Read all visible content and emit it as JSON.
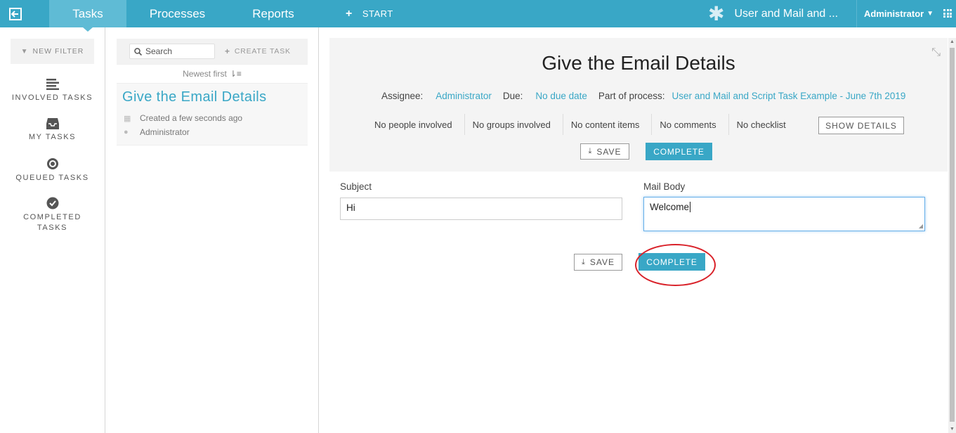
{
  "topbar": {
    "tabs": [
      {
        "label": "Tasks",
        "active": true
      },
      {
        "label": "Processes",
        "active": false
      },
      {
        "label": "Reports",
        "active": false
      }
    ],
    "start_label": "START",
    "app_name": "User and Mail and ...",
    "user_name": "Administrator",
    "accent_color": "#39a7c6"
  },
  "sidebar": {
    "new_filter": "NEW FILTER",
    "items": [
      {
        "label": "INVOLVED TASKS",
        "icon": "list-icon"
      },
      {
        "label": "MY TASKS",
        "icon": "inbox-icon"
      },
      {
        "label": "QUEUED TASKS",
        "icon": "target-icon"
      },
      {
        "label": "COMPLETED TASKS",
        "icon": "check-circle-icon"
      }
    ]
  },
  "task_list": {
    "search_placeholder": "Search",
    "create_task": "CREATE TASK",
    "sort_label": "Newest first",
    "tasks": [
      {
        "title": "Give the Email Details",
        "created": "Created a few seconds ago",
        "assignee": "Administrator"
      }
    ]
  },
  "detail": {
    "title": "Give the Email Details",
    "assignee_label": "Assignee:",
    "assignee_value": "Administrator",
    "due_label": "Due:",
    "due_value": "No due date",
    "process_label": "Part of process:",
    "process_value": "User and Mail and Script Task Example - June 7th 2019",
    "involvement": [
      "No people involved",
      "No groups involved",
      "No content items",
      "No comments",
      "No checklist"
    ],
    "show_details": "SHOW DETAILS",
    "save": "SAVE",
    "complete": "COMPLETE"
  },
  "form": {
    "subject_label": "Subject",
    "subject_value": "Hi",
    "body_label": "Mail Body",
    "body_value": "Welcome",
    "save": "SAVE",
    "complete": "COMPLETE"
  }
}
